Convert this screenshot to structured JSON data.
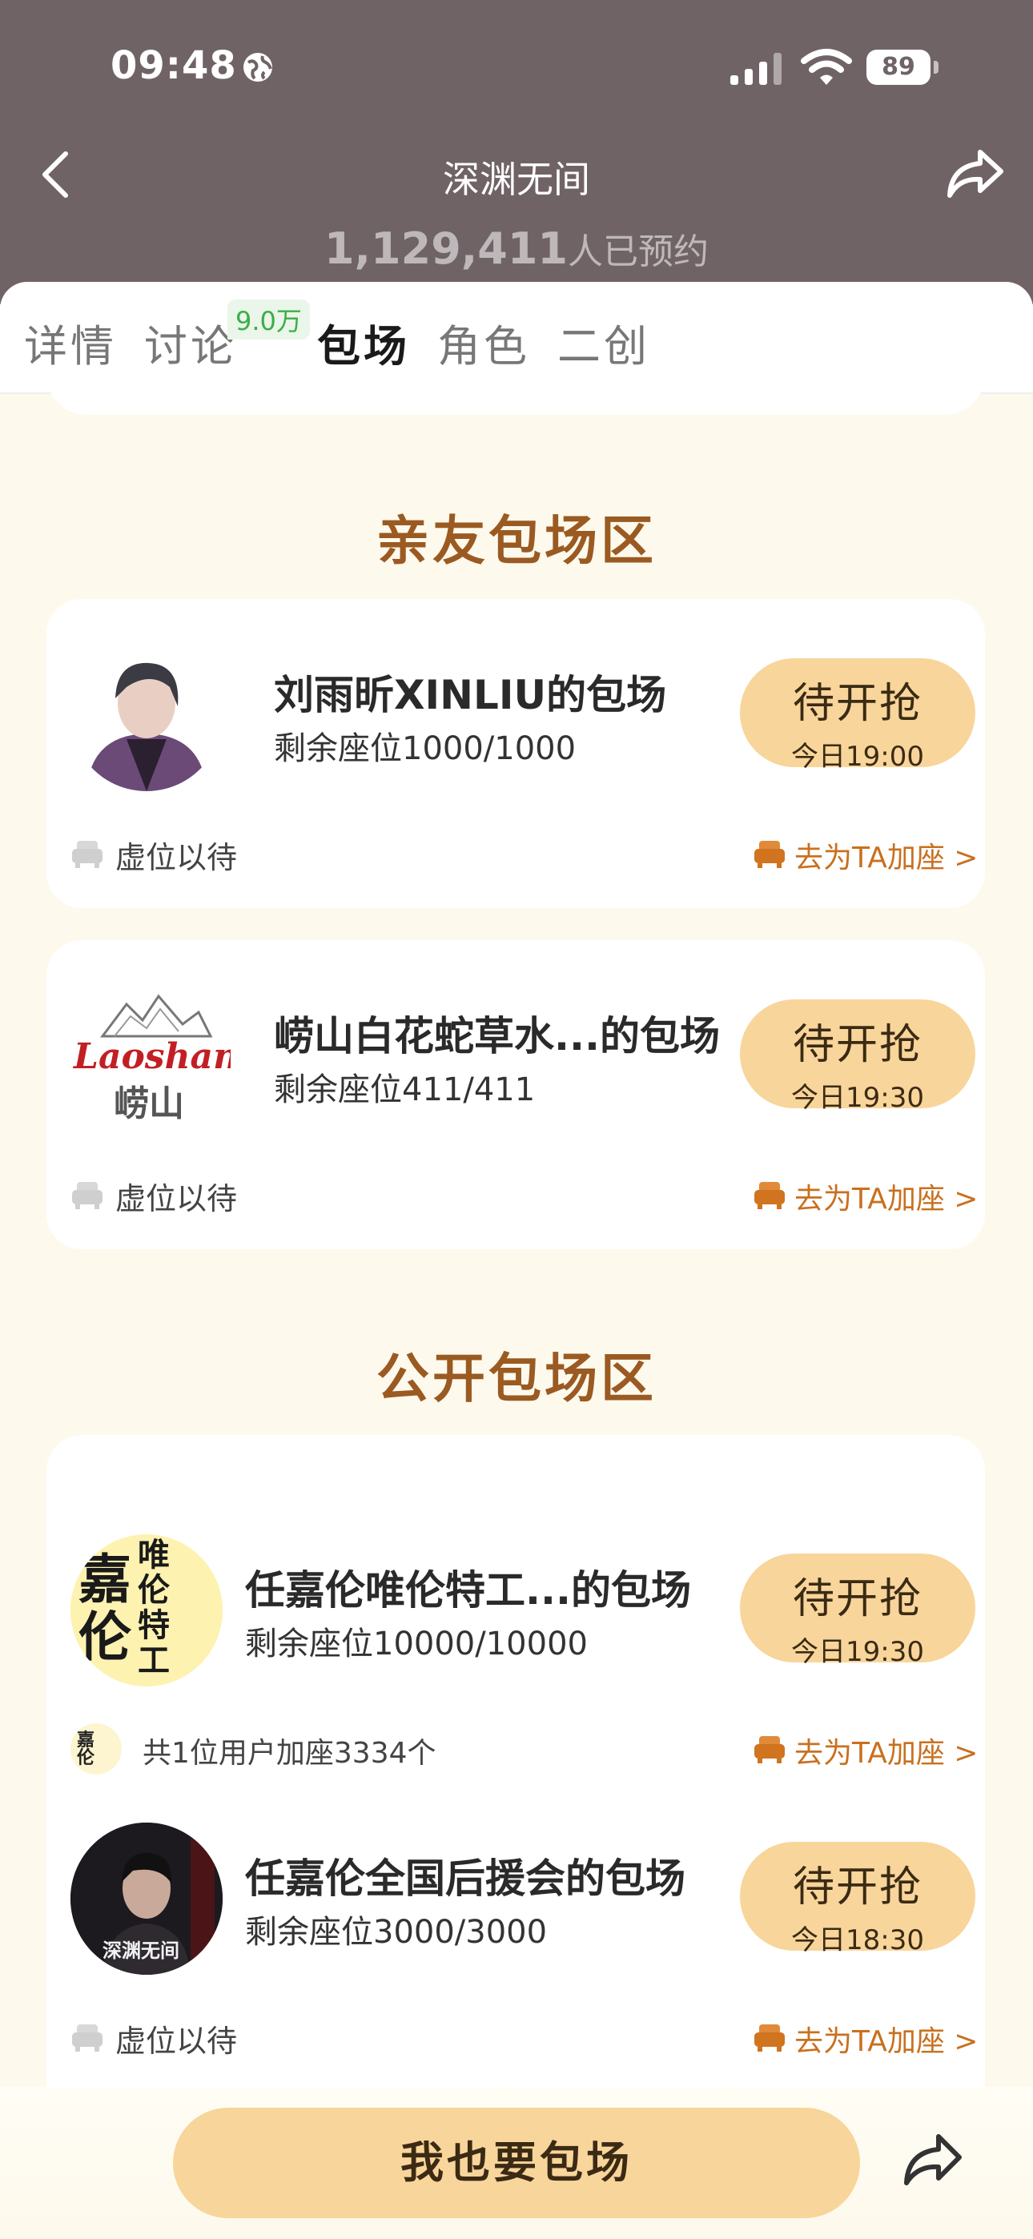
{
  "status_bar": {
    "time": "09:48",
    "battery": "89"
  },
  "header": {
    "title": "深渊无间",
    "reserve_count": "1,129,411",
    "reserve_suffix": "人已预约"
  },
  "tabs": [
    {
      "label": "详情"
    },
    {
      "label": "讨论",
      "badge": "9.0万"
    },
    {
      "label": "包场",
      "active": true
    },
    {
      "label": "角色"
    },
    {
      "label": "二创"
    }
  ],
  "sections": {
    "friends_title": "亲友包场区",
    "public_title": "公开包场区"
  },
  "friends_items": [
    {
      "title": "刘雨昕XINLIU的包场",
      "seats": "剩余座位1000/1000",
      "button": "待开抢",
      "time": "今日19:00",
      "footer": "虚位以待",
      "link": "去为TA加座 >"
    },
    {
      "title": "崂山白花蛇草水...的包场",
      "seats": "剩余座位411/411",
      "button": "待开抢",
      "time": "今日19:30",
      "footer": "虚位以待",
      "link": "去为TA加座 >",
      "logo_text": "Laoshan",
      "logo_cn": "崂山"
    }
  ],
  "public_items": [
    {
      "title": "任嘉伦唯伦特工...的包场",
      "seats": "剩余座位10000/10000",
      "button": "待开抢",
      "time": "今日19:30",
      "footer": "共1位用户加座3334个",
      "link": "去为TA加座 >",
      "avatar_text": "嘉伦",
      "avatar_text2": "唯伦特工",
      "mini_text": "嘉伦"
    },
    {
      "title": "任嘉伦全国后援会的包场",
      "seats": "剩余座位3000/3000",
      "button": "待开抢",
      "time": "今日18:30",
      "footer": "虚位以待",
      "link": "去为TA加座 >",
      "avatar_text": "深渊无间"
    }
  ],
  "bottom": {
    "cta": "我也要包场"
  },
  "colors": {
    "header_bg": "#706366",
    "accent": "#f8d59a",
    "section_title": "#9a5a22",
    "link": "#c9701f",
    "page_bg": "#fdf9ec"
  }
}
